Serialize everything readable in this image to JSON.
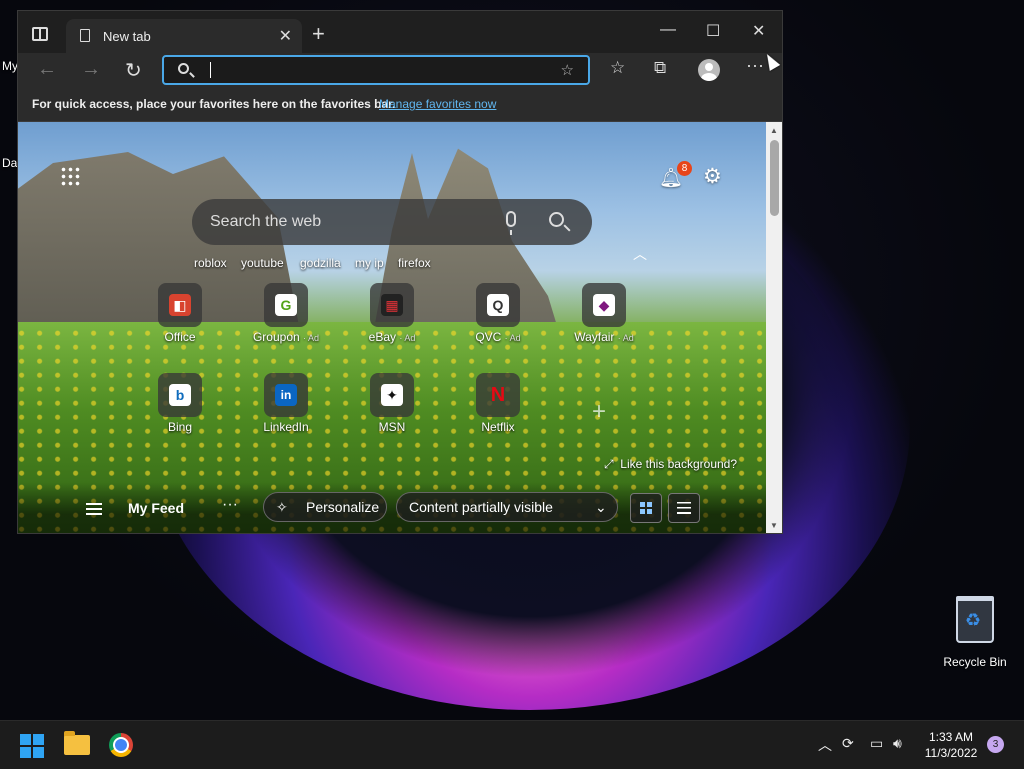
{
  "desktop": {
    "partial_labels": [
      "My",
      "Da"
    ],
    "recycle_bin": {
      "label": "Recycle Bin"
    }
  },
  "browser": {
    "tab": {
      "title": "New tab",
      "close": "✕"
    },
    "new_tab_symbol": "+",
    "window_controls": {
      "minimize": "—",
      "maximize": "☐",
      "close": "✕"
    },
    "nav": {
      "back": "←",
      "forward": "→",
      "refresh": "↻"
    },
    "address": {
      "value": "",
      "placeholder": ""
    },
    "toolbar_icons": [
      "favorites-icon",
      "collections-icon",
      "profile-icon",
      "more-icon"
    ],
    "favorites_bar": {
      "message": "For quick access, place your favorites here on the favorites bar.",
      "link": "Manage favorites now"
    }
  },
  "newtab": {
    "notifications_count": "8",
    "search": {
      "placeholder": "Search the web"
    },
    "quick_searches": [
      "roblox",
      "youtube",
      "godzilla",
      "my ip",
      "firefox"
    ],
    "tiles": [
      {
        "label": "Office",
        "ad": "",
        "icon": "office-icon",
        "glyph": "◧",
        "color": "#d8432f"
      },
      {
        "label": "Groupon",
        "ad": "· Ad",
        "icon": "groupon-icon",
        "glyph": "G",
        "color": "#53a318"
      },
      {
        "label": "eBay",
        "ad": "· Ad",
        "icon": "ebay-icon",
        "glyph": "▦",
        "color": "#e53238"
      },
      {
        "label": "QVC",
        "ad": "· Ad",
        "icon": "qvc-icon",
        "glyph": "Q",
        "color": "#ffffff"
      },
      {
        "label": "Wayfair",
        "ad": "· Ad",
        "icon": "wayfair-icon",
        "glyph": "◆",
        "color": "#7f187f"
      },
      {
        "label": "Bing",
        "ad": "",
        "icon": "bing-icon",
        "glyph": "b",
        "color": "#ffffff"
      },
      {
        "label": "LinkedIn",
        "ad": "",
        "icon": "linkedin-icon",
        "glyph": "in",
        "color": "#0a66c2"
      },
      {
        "label": "MSN",
        "ad": "",
        "icon": "msn-icon",
        "glyph": "✦",
        "color": "#ffffff"
      },
      {
        "label": "Netflix",
        "ad": "",
        "icon": "netflix-icon",
        "glyph": "N",
        "color": "#e50914"
      }
    ],
    "like_background": "Like this background?",
    "feed": {
      "title": "My Feed",
      "more": "···",
      "personalize": "Personalize",
      "content_visibility": "Content partially visible"
    }
  },
  "taskbar": {
    "time": "1:33 AM",
    "date": "11/3/2022",
    "notifications": "3"
  }
}
